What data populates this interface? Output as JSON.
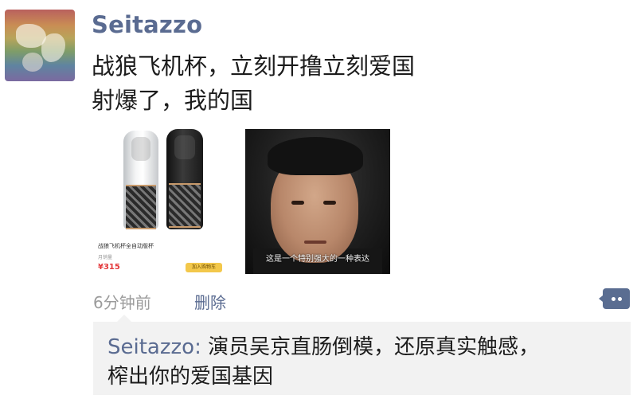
{
  "post": {
    "username": "Seitazzo",
    "content_lines": [
      "战狼飞机杯，立刻开撸立刻爱国",
      "射爆了，我的国"
    ],
    "product_image": {
      "caption": "战狼飞机杯全自动版杯",
      "sub": "月销量",
      "price": "¥315",
      "badge": "加入购物车"
    },
    "face_image": {
      "subtitle": "这是一个特别强大的一种表达"
    },
    "timestamp": "6分钟前",
    "delete_label": "删除",
    "comment_icon": "comment-icon"
  },
  "reply": {
    "author": "Seitazzo",
    "separator": ": ",
    "text_line1": "演员吴京直肠倒模，还原真实触感，",
    "text_line2": "榨出你的爱国基因"
  },
  "colors": {
    "link": "#5a6b91",
    "meta": "#9b9b9b",
    "reply_bg": "#f2f2f2",
    "text": "#1c1c1c"
  }
}
